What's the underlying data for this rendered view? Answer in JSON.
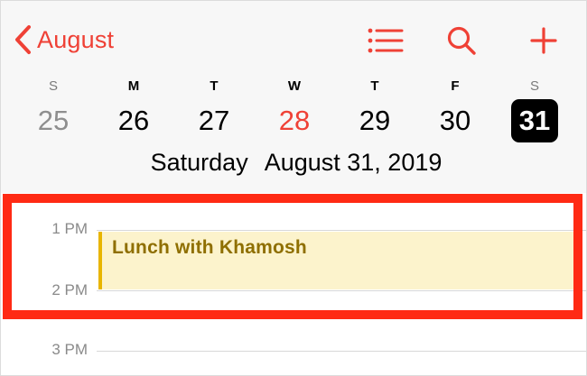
{
  "nav": {
    "back_label": "August",
    "icons": [
      "list-icon",
      "search-icon",
      "plus-icon"
    ]
  },
  "week": {
    "days": [
      {
        "letter": "S",
        "number": "25",
        "state": "muted"
      },
      {
        "letter": "M",
        "number": "26",
        "state": "normal"
      },
      {
        "letter": "T",
        "number": "27",
        "state": "normal"
      },
      {
        "letter": "W",
        "number": "28",
        "state": "today"
      },
      {
        "letter": "T",
        "number": "29",
        "state": "normal"
      },
      {
        "letter": "F",
        "number": "30",
        "state": "normal"
      },
      {
        "letter": "S",
        "number": "31",
        "state": "selected"
      }
    ]
  },
  "selected_date": {
    "weekday": "Saturday",
    "date": "August 31, 2019"
  },
  "timeline": {
    "hours": [
      "1 PM",
      "2 PM",
      "3 PM"
    ]
  },
  "event": {
    "title": "Lunch with Khamosh"
  },
  "colors": {
    "accent": "#ef4136",
    "event_bg": "#fcf3cc",
    "event_bar": "#e8b500",
    "event_text": "#8f6f00",
    "highlight": "#ff2a14"
  }
}
